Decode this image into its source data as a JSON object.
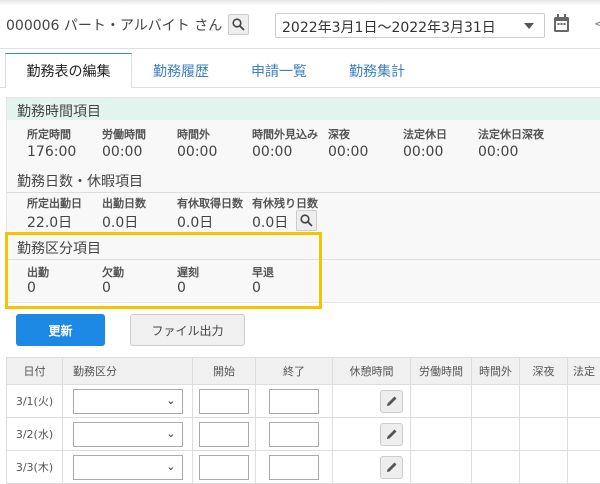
{
  "header": {
    "employee": "000006 パート・アルバイト さん",
    "date_range": "2022年3月1日～2022年3月31日",
    "prev": "<"
  },
  "tabs": [
    {
      "label": "勤務表の編集"
    },
    {
      "label": "勤務履歴"
    },
    {
      "label": "申請一覧"
    },
    {
      "label": "勤務集計"
    }
  ],
  "sections": {
    "work_time": {
      "title": "勤務時間項目",
      "items": [
        {
          "label": "所定時間",
          "value": "176:00"
        },
        {
          "label": "労働時間",
          "value": "00:00"
        },
        {
          "label": "時間外",
          "value": "00:00"
        },
        {
          "label": "時間外見込み",
          "value": "00:00"
        },
        {
          "label": "深夜",
          "value": "00:00"
        },
        {
          "label": "法定休日",
          "value": "00:00"
        },
        {
          "label": "法定休日深夜",
          "value": "00:00"
        }
      ]
    },
    "work_days": {
      "title": "勤務日数・休暇項目",
      "items": [
        {
          "label": "所定出勤日",
          "value": "22.0日"
        },
        {
          "label": "出勤日数",
          "value": "0.0日"
        },
        {
          "label": "有休取得日数",
          "value": "0.0日"
        },
        {
          "label": "有休残り日数",
          "value": "0.0日"
        }
      ]
    },
    "work_type": {
      "title": "勤務区分項目",
      "items": [
        {
          "label": "出勤",
          "value": "0"
        },
        {
          "label": "欠勤",
          "value": "0"
        },
        {
          "label": "遅刻",
          "value": "0"
        },
        {
          "label": "早退",
          "value": "0"
        }
      ]
    }
  },
  "buttons": {
    "update": "更新",
    "export": "ファイル出力"
  },
  "table": {
    "headers": [
      "日付",
      "勤務区分",
      "開始",
      "終了",
      "休憩時間",
      "労働時間",
      "時間外",
      "深夜",
      "法定"
    ],
    "rows": [
      {
        "date": "3/1(火)"
      },
      {
        "date": "3/2(水)"
      },
      {
        "date": "3/3(木)"
      }
    ]
  },
  "colors": {
    "accent": "#1e88e5",
    "highlight": "#f7c200",
    "section_bg": "#e3f4ee"
  }
}
